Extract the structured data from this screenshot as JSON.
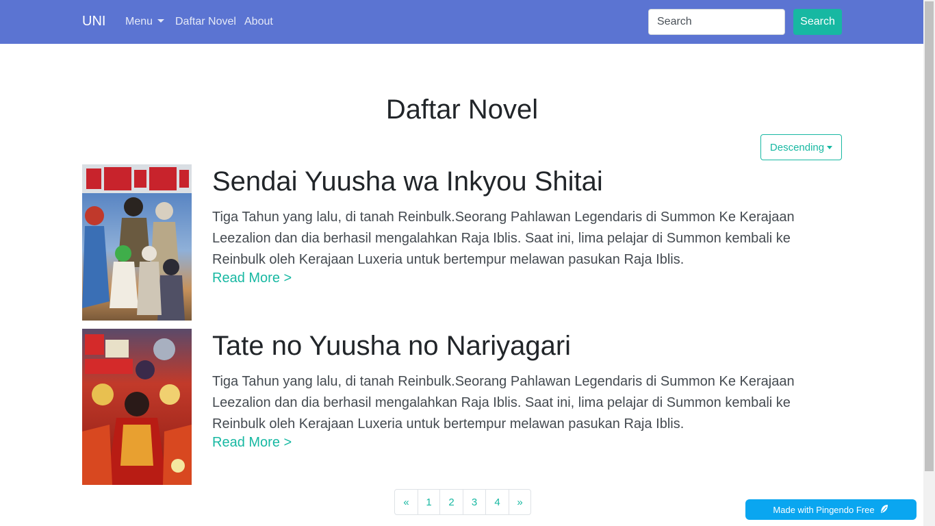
{
  "nav": {
    "brand": "UNI",
    "menu_label": "Menu",
    "links": [
      "Daftar Novel",
      "About"
    ],
    "search_placeholder": "Search",
    "search_button": "Search"
  },
  "page_title": "Daftar Novel",
  "sort": {
    "label": "Descending"
  },
  "novels": [
    {
      "title": "Sendai Yuusha wa Inkyou Shitai",
      "description": "Tiga Tahun yang lalu, di tanah Reinbulk.Seorang Pahlawan Legendaris di Summon Ke Kerajaan Leezalion dan dia berhasil mengalahkan Raja Iblis. Saat ini, lima pelajar di Summon kembali ke Reinbulk oleh Kerajaan Luxeria untuk bertempur melawan pasukan Raja Iblis.",
      "read_more": "Read More >"
    },
    {
      "title": "Tate no Yuusha no Nariyagari",
      "description": "Tiga Tahun yang lalu, di tanah Reinbulk.Seorang Pahlawan Legendaris di Summon Ke Kerajaan Leezalion dan dia berhasil mengalahkan Raja Iblis. Saat ini, lima pelajar di Summon kembali ke Reinbulk oleh Kerajaan Luxeria untuk bertempur melawan pasukan Raja Iblis.",
      "read_more": "Read More >"
    }
  ],
  "pagination": [
    "«",
    "1",
    "2",
    "3",
    "4",
    "»"
  ],
  "footer_badge": "Made with Pingendo Free",
  "colors": {
    "navbar": "#5b74d2",
    "accent": "#17b8a2",
    "badge": "#0aa6f0"
  }
}
